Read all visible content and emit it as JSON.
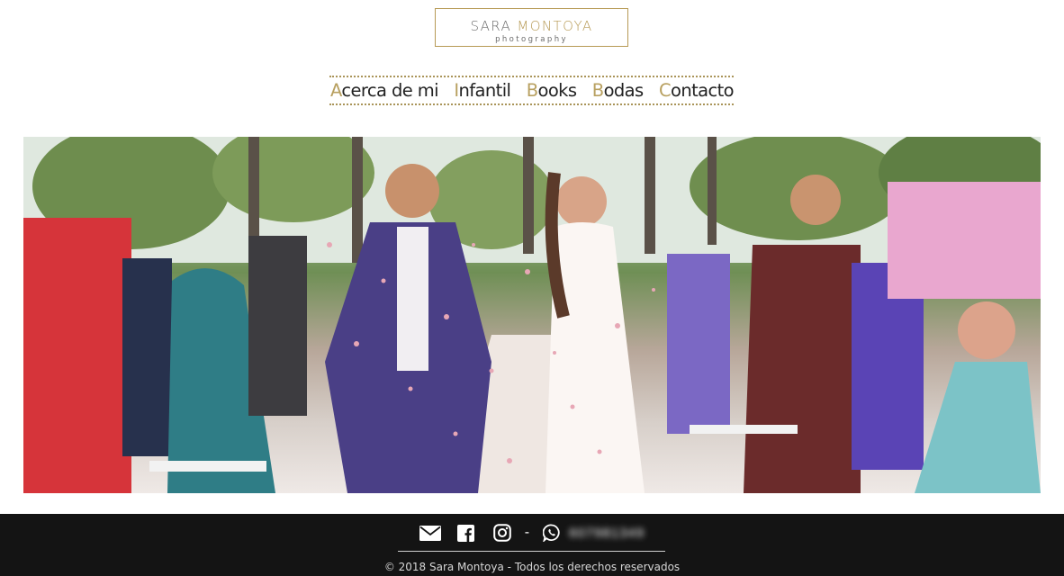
{
  "logo": {
    "name_first": "SARA",
    "name_last": "MONTOYA",
    "subtitle": "photography"
  },
  "nav": {
    "items": [
      {
        "initial": "A",
        "rest": "cerca de mi"
      },
      {
        "initial": "I",
        "rest": "nfantil"
      },
      {
        "initial": "B",
        "rest": "ooks"
      },
      {
        "initial": "B",
        "rest": "odas"
      },
      {
        "initial": "C",
        "rest": "ontacto"
      }
    ]
  },
  "hero": {
    "alt": "wedding-couple-confetti-photo"
  },
  "footer": {
    "icons": [
      "envelope-icon",
      "facebook-icon",
      "instagram-icon",
      "whatsapp-icon"
    ],
    "separator": "-",
    "phone": "607981349",
    "copyright": "© 2018 Sara Montoya - Todos los derechos reservados"
  },
  "colors": {
    "accent_gold": "#b79a55",
    "footer_bg": "#141414",
    "text_dark": "#222222"
  }
}
